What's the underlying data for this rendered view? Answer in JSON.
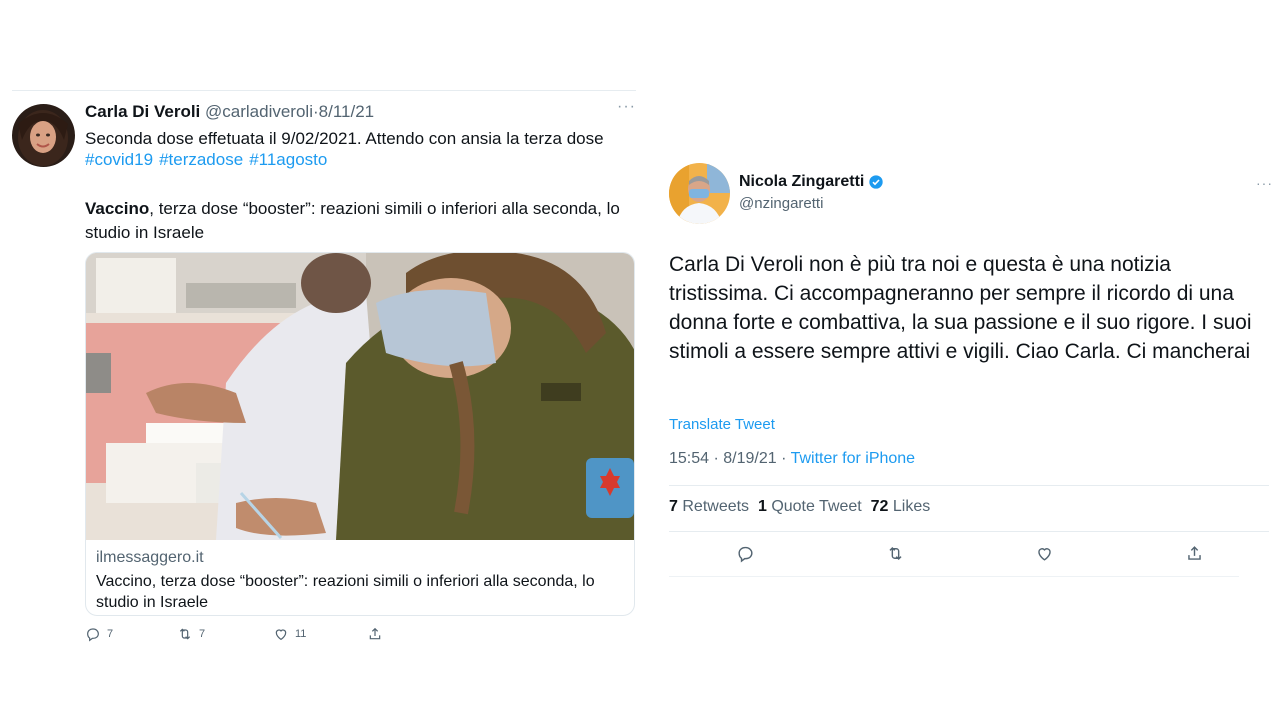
{
  "left_tweet": {
    "author_name": "Carla Di Veroli",
    "handle": "@carladiveroli",
    "separator": "·",
    "date": "8/11/21",
    "more": "···",
    "text": "Seconda dose effetuata il 9/02/2021. Attendo con ansia la terza dose",
    "hashtags": [
      "#covid19",
      "#terzadose",
      "#11agosto"
    ],
    "article_bold": "Vaccino",
    "article_rest": ", terza dose “booster”: reazioni simili o inferiori alla seconda, lo studio in Israele",
    "card": {
      "domain": "ilmessaggero.it",
      "title": "Vaccino, terza dose “booster”: reazioni simili o inferiori alla seconda, lo studio in Israele"
    },
    "actions": {
      "replies": "7",
      "retweets": "7",
      "likes": "11"
    }
  },
  "right_tweet": {
    "author_name": "Nicola Zingaretti",
    "handle": "@nzingaretti",
    "more": "···",
    "text": "Carla Di Veroli non è più tra noi e questa è una notizia tristissima. Ci accompagneranno per sempre il ricordo di una donna forte e combattiva, la  sua passione e il suo rigore. I suoi stimoli a essere sempre attivi e vigili. Ciao Carla. Ci mancherai",
    "translate": "Translate Tweet",
    "time": "15:54 · 8/19/21 · ",
    "source": "Twitter for iPhone",
    "stats": {
      "retweets_count": "7",
      "retweets_label": "Retweets",
      "quotes_count": "1",
      "quotes_label": "Quote Tweet",
      "likes_count": "72",
      "likes_label": "Likes"
    }
  },
  "colors": {
    "link": "#1d9bf0",
    "secondary": "#536471",
    "verified": "#1d9bf0"
  }
}
